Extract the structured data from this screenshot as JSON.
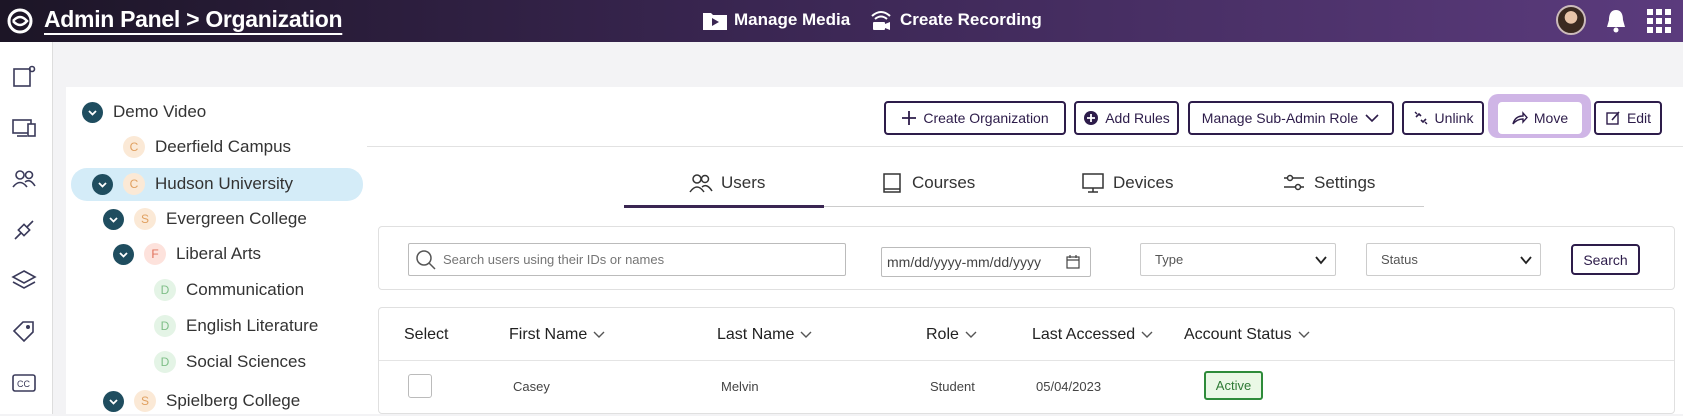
{
  "header": {
    "breadcrumb": "Admin Panel > Organization",
    "manage_media": "Manage Media",
    "create_recording": "Create Recording"
  },
  "tree": [
    {
      "label": "Demo Video",
      "letter": ""
    },
    {
      "label": "Deerfield Campus",
      "letter": "C"
    },
    {
      "label": "Hudson University",
      "letter": "C"
    },
    {
      "label": "Evergreen College",
      "letter": "S"
    },
    {
      "label": "Liberal Arts",
      "letter": "F"
    },
    {
      "label": "Communication",
      "letter": "D"
    },
    {
      "label": "English Literature",
      "letter": "D"
    },
    {
      "label": "Social Sciences",
      "letter": "D"
    },
    {
      "label": "Spielberg College",
      "letter": "S"
    }
  ],
  "toolbar": {
    "create_org": "Create Organization",
    "add_rules": "Add Rules",
    "manage_subadmin": "Manage Sub-Admin Role",
    "unlink": "Unlink",
    "move": "Move",
    "edit": "Edit"
  },
  "tabs": {
    "users": "Users",
    "courses": "Courses",
    "devices": "Devices",
    "settings": "Settings"
  },
  "filters": {
    "search_placeholder": "Search users using their IDs or names",
    "date_placeholder": "mm/dd/yyyy-mm/dd/yyyy",
    "type": "Type",
    "status": "Status",
    "search_button": "Search"
  },
  "table": {
    "headers": {
      "select": "Select",
      "first_name": "First Name",
      "last_name": "Last Name",
      "role": "Role",
      "last_accessed": "Last Accessed",
      "account_status": "Account Status"
    },
    "rows": [
      {
        "first_name": "Casey",
        "last_name": "Melvin",
        "role": "Student",
        "last_accessed": "05/04/2023",
        "status": "Active"
      }
    ]
  }
}
